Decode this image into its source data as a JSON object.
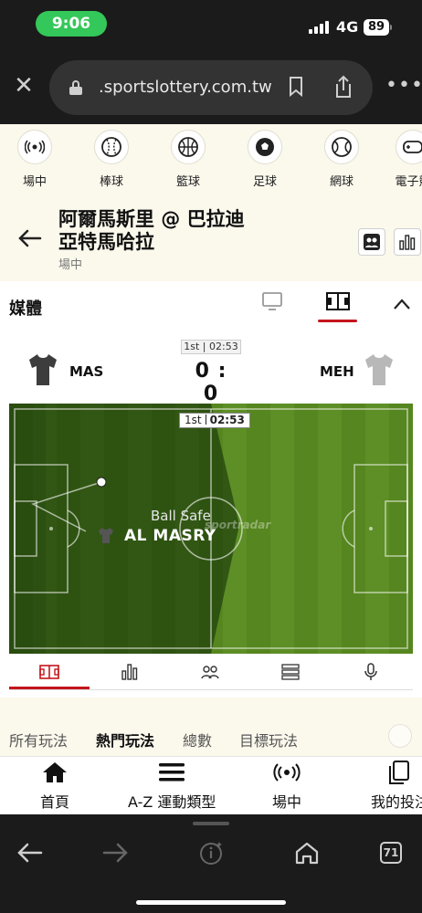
{
  "status_bar": {
    "time": "9:06",
    "network": "4G",
    "battery": "89"
  },
  "browser": {
    "url": ".sportslottery.com.tw",
    "tabs_count": "71"
  },
  "sports_nav": [
    {
      "label": "場中",
      "icon": "live-broadcast-icon"
    },
    {
      "label": "棒球",
      "icon": "baseball-icon"
    },
    {
      "label": "籃球",
      "icon": "basketball-icon"
    },
    {
      "label": "足球",
      "icon": "soccer-ball-icon"
    },
    {
      "label": "網球",
      "icon": "tennis-ball-icon"
    },
    {
      "label": "電子競",
      "icon": "esports-icon"
    }
  ],
  "event": {
    "title_line1": "阿爾馬斯里 @ 巴拉迪",
    "title_line2": "亞特馬哈拉",
    "status": "場中"
  },
  "media": {
    "label": "媒體"
  },
  "match": {
    "period_clock": "1st | 02:53",
    "home_team": "MAS",
    "away_team": "MEH",
    "score": "0 : 0"
  },
  "pitch": {
    "period": "1st",
    "clock": "02:53",
    "event_text": "Ball Safe",
    "event_team": "AL MASRY",
    "watermark": "sportradar"
  },
  "market_tabs": [
    {
      "label": "所有玩法",
      "active": false
    },
    {
      "label": "熱門玩法",
      "active": true
    },
    {
      "label": "總數",
      "active": false
    },
    {
      "label": "目標玩法",
      "active": false
    }
  ],
  "app_nav": [
    {
      "label": "首頁",
      "icon": "home-icon"
    },
    {
      "label": "A-Z 運動類型",
      "icon": "menu-icon"
    },
    {
      "label": "場中",
      "icon": "live-broadcast-icon"
    },
    {
      "label": "我的投注",
      "icon": "bets-icon"
    }
  ],
  "colors": {
    "accent": "#c4161c",
    "pitch_green": "#5a8a23",
    "status_green": "#34c759"
  }
}
